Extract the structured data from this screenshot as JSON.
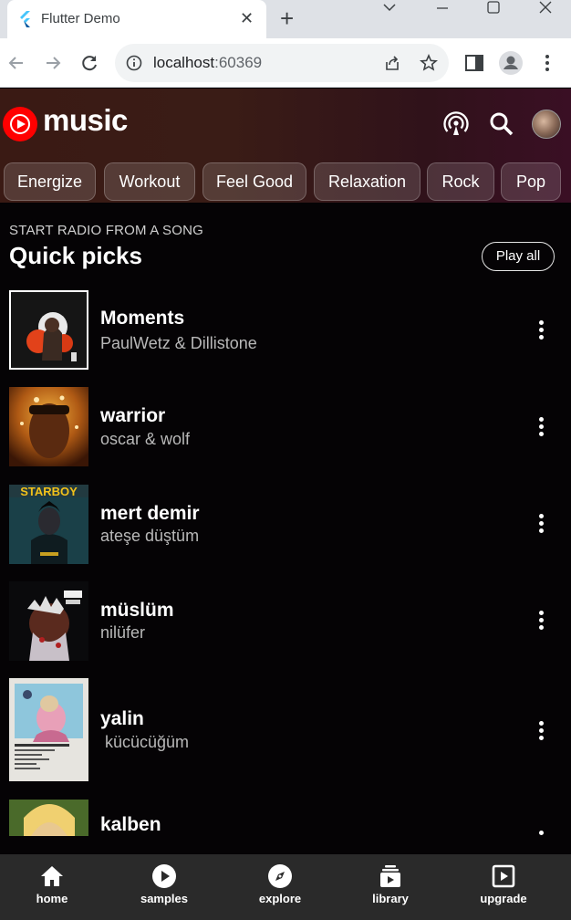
{
  "browser": {
    "tab_title": "Flutter Demo",
    "url_host": "localhost",
    "url_port": ":60369"
  },
  "app": {
    "logo_text": "music",
    "chips": [
      "Energize",
      "Workout",
      "Feel Good",
      "Relaxation",
      "Rock",
      "Pop"
    ],
    "section": {
      "kicker": "START RADIO FROM A SONG",
      "title": "Quick picks",
      "play_all": "Play all"
    },
    "songs": [
      {
        "title": "Moments",
        "artist": "PaulWetz & Dillistone"
      },
      {
        "title": "warrior",
        "artist": "oscar & wolf"
      },
      {
        "title": "mert demir",
        "artist": "ateşe düştüm"
      },
      {
        "title": "müslüm",
        "artist": "nilüfer"
      },
      {
        "title": "yalin",
        "artist": " kücücüğüm"
      },
      {
        "title": "kalben",
        "artist": ""
      }
    ],
    "cover_texts": {
      "starboy": "STARBOY"
    },
    "bottom_nav": [
      {
        "label": "home",
        "icon": "home-icon"
      },
      {
        "label": "samples",
        "icon": "play-circle-icon"
      },
      {
        "label": "explore",
        "icon": "compass-icon"
      },
      {
        "label": "library",
        "icon": "library-icon"
      },
      {
        "label": "upgrade",
        "icon": "upgrade-icon"
      }
    ],
    "colors": {
      "accent_red": "#ff0000",
      "background": "#050305",
      "nav_background": "#2a2a2a"
    }
  }
}
